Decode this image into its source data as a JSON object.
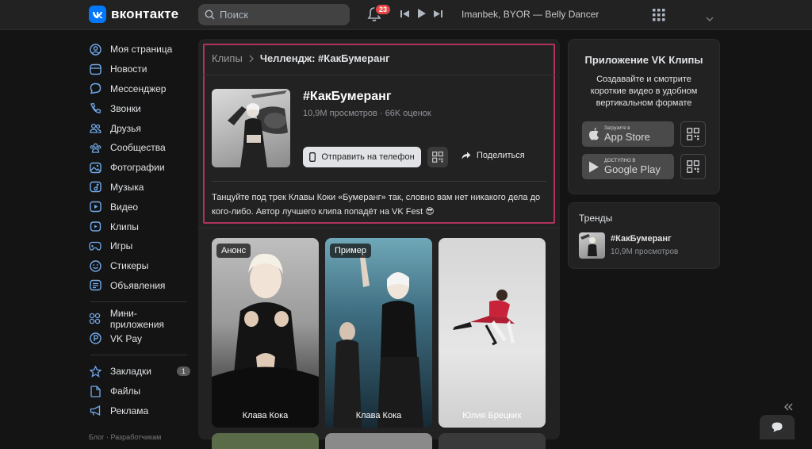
{
  "header": {
    "logo_text": "вконтакте",
    "search_placeholder": "Поиск",
    "notifications_count": "23",
    "now_playing": "Imanbek, BYOR — Belly Dancer"
  },
  "sidebar": {
    "items": [
      {
        "label": "Моя страница",
        "icon": "user-circle-icon"
      },
      {
        "label": "Новости",
        "icon": "news-icon"
      },
      {
        "label": "Мессенджер",
        "icon": "message-icon"
      },
      {
        "label": "Звонки",
        "icon": "phone-icon"
      },
      {
        "label": "Друзья",
        "icon": "friends-icon"
      },
      {
        "label": "Сообщества",
        "icon": "communities-icon"
      },
      {
        "label": "Фотографии",
        "icon": "photo-icon"
      },
      {
        "label": "Музыка",
        "icon": "music-icon"
      },
      {
        "label": "Видео",
        "icon": "video-icon"
      },
      {
        "label": "Клипы",
        "icon": "clips-icon"
      },
      {
        "label": "Игры",
        "icon": "gamepad-icon"
      },
      {
        "label": "Стикеры",
        "icon": "sticker-icon"
      },
      {
        "label": "Объявления",
        "icon": "ads-icon"
      }
    ],
    "items2": [
      {
        "label": "Мини-приложения",
        "icon": "mini-apps-icon"
      },
      {
        "label": "VK Pay",
        "icon": "vkpay-icon"
      }
    ],
    "items3": [
      {
        "label": "Закладки",
        "icon": "star-icon",
        "count": "1"
      },
      {
        "label": "Файлы",
        "icon": "file-icon"
      },
      {
        "label": "Реклама",
        "icon": "megaphone-icon"
      }
    ],
    "footer": "Блог · Разработчикам"
  },
  "breadcrumb": {
    "parent": "Клипы",
    "current": "Челлендж: #КакБумеранг"
  },
  "challenge": {
    "title": "#КакБумеранг",
    "stats": "10,9M просмотров · 66K оценок",
    "send_label": "Отправить на телефон",
    "share_label": "Поделиться",
    "description": "Танцуйте под трек Клавы Коки «Бумеранг» так, словно вам нет никакого дела до кого-либо. Автор лучшего клипа попадёт на VK Fest 😎"
  },
  "clips": [
    {
      "tag": "Анонс",
      "author": "Клава Кока"
    },
    {
      "tag": "Пример",
      "author": "Клава Кока"
    },
    {
      "tag": "",
      "author": "Юлия Брецких"
    }
  ],
  "app_promo": {
    "title": "Приложение VK Клипы",
    "description": "Создавайте и смотрите короткие видео в удобном вертикальном формате",
    "appstore_small": "Загрузите в",
    "appstore_big": "App Store",
    "googleplay_small": "ДОСТУПНО В",
    "googleplay_big": "Google Play"
  },
  "trends": {
    "title": "Тренды",
    "item_name": "#КакБумеранг",
    "item_stats": "10,9M просмотров"
  }
}
